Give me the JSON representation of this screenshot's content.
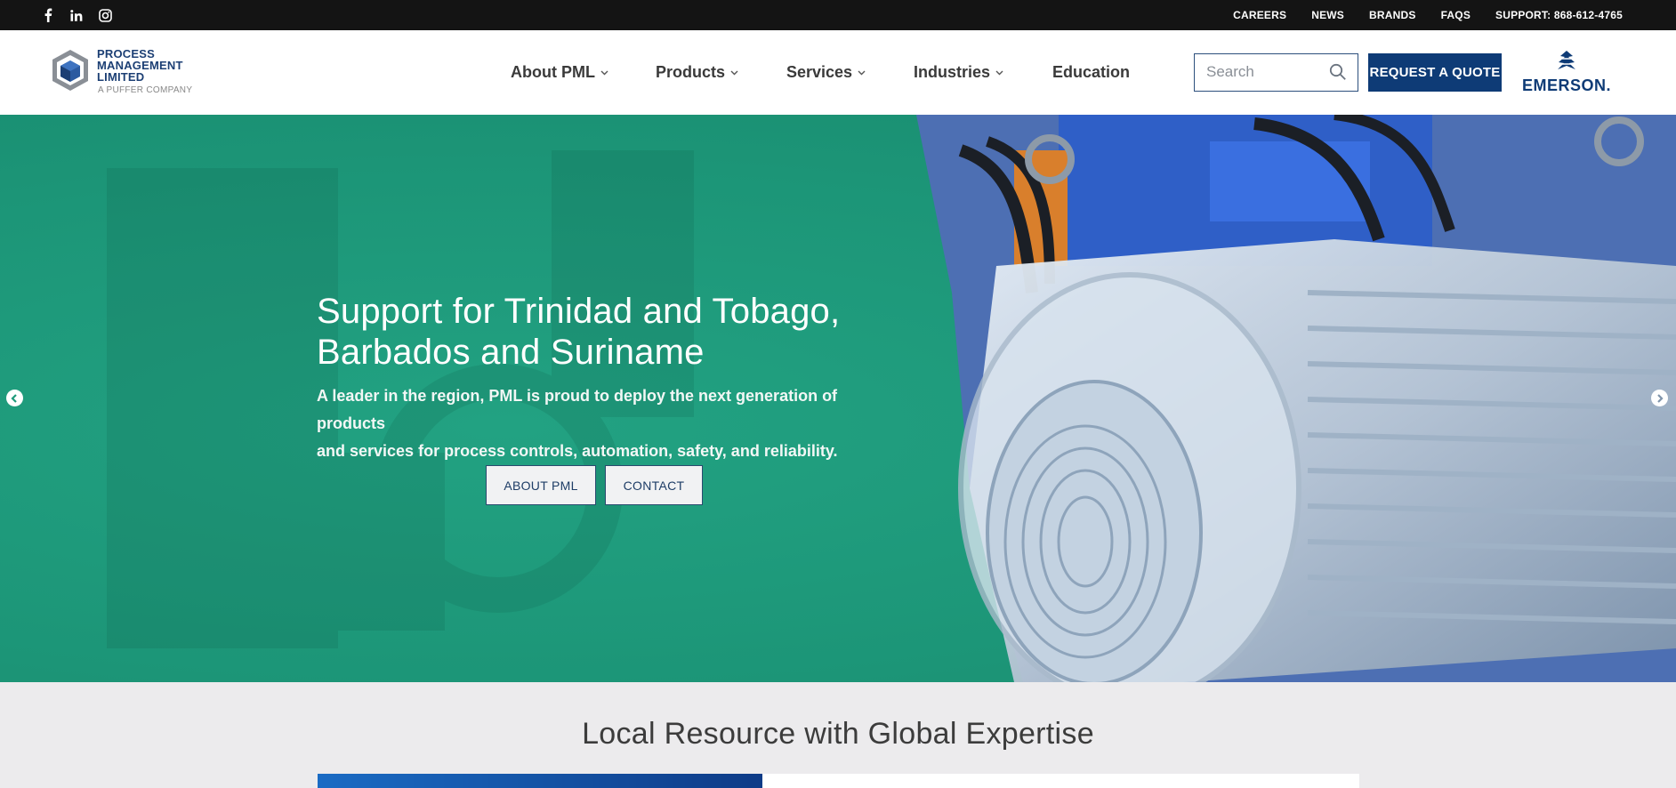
{
  "topbar": {
    "social": [
      {
        "name": "facebook-icon"
      },
      {
        "name": "linkedin-icon"
      },
      {
        "name": "instagram-icon"
      }
    ],
    "links": [
      {
        "label": "CAREERS"
      },
      {
        "label": "NEWS"
      },
      {
        "label": "BRANDS"
      },
      {
        "label": "FAQS"
      },
      {
        "label": "SUPPORT: 868-612-4765"
      }
    ]
  },
  "logo": {
    "line1": "PROCESS",
    "line2": "MANAGEMENT",
    "line3": "LIMITED",
    "tagline": "A PUFFER COMPANY"
  },
  "nav": {
    "items": [
      {
        "label": "About PML",
        "has_dropdown": true
      },
      {
        "label": "Products",
        "has_dropdown": true
      },
      {
        "label": "Services",
        "has_dropdown": true
      },
      {
        "label": "Industries",
        "has_dropdown": true
      },
      {
        "label": "Education",
        "has_dropdown": false
      }
    ]
  },
  "search": {
    "placeholder": "Search"
  },
  "quote_button": {
    "label": "REQUEST A QUOTE"
  },
  "partner_logo": {
    "label": "EMERSON."
  },
  "hero": {
    "title_line1": "Support for Trinidad and Tobago,",
    "title_line2": "Barbados and Suriname",
    "description_line1": "A leader in the region, PML is proud to deploy the next generation of products",
    "description_line2": "and services for process controls, automation, safety, and reliability.",
    "buttons": [
      {
        "label": "ABOUT PML"
      },
      {
        "label": "CONTACT"
      }
    ],
    "background_color": "#1f9a7b"
  },
  "section": {
    "title": "Local Resource with Global Expertise"
  },
  "colors": {
    "brand_navy": "#0e3b76",
    "hero_green": "#1f9a7b",
    "topbar": "#141414"
  }
}
